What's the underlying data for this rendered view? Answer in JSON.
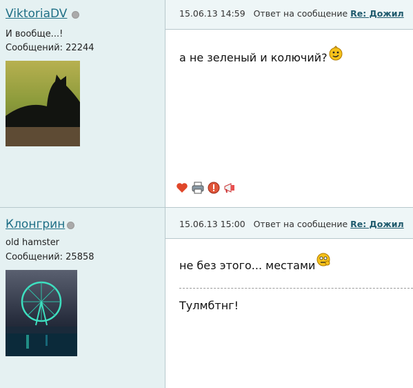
{
  "posts": [
    {
      "username": "ViktoriaDV",
      "user_title": "И вообще...!",
      "post_count": "Сообщений: 22244",
      "date": "15.06.13 14:59",
      "reply_text": "Ответ на сообщение",
      "reply_link": "Re: Дожил",
      "body": "а не зеленый и колючий?",
      "status_color": "#aaaaaa"
    },
    {
      "username": "Клонгрин",
      "user_title": "old hamster",
      "post_count": "Сообщений: 25858",
      "date": "15.06.13 15:00",
      "reply_text": "Ответ на сообщение",
      "reply_link": "Re: Дожил",
      "body": "не без этого... местами",
      "signature": "Тулмбтнг!",
      "status_color": "#aaaaaa"
    }
  ],
  "tools": [
    "heart-icon",
    "print-icon",
    "report-icon",
    "megaphone-icon"
  ],
  "colors": {
    "sidebar_bg": "#e5f1f2",
    "header_bg": "#eef6f7",
    "border": "#b7c8cc",
    "username": "#1f6f86",
    "link": "#1f5a6d"
  }
}
